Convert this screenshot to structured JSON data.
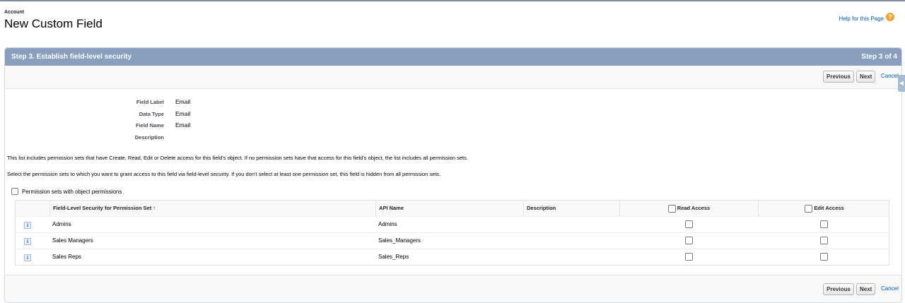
{
  "header": {
    "object_label": "Account",
    "title": "New Custom Field",
    "help_link": "Help for this Page",
    "help_icon": "?"
  },
  "step": {
    "title": "Step 3. Establish field-level security",
    "counter": "Step 3 of 4"
  },
  "buttons": {
    "previous": "Previous",
    "next": "Next",
    "cancel": "Cancel"
  },
  "details": [
    {
      "label": "Field Label",
      "value": "Email"
    },
    {
      "label": "Data Type",
      "value": "Email"
    },
    {
      "label": "Field Name",
      "value": "Email"
    },
    {
      "label": "Description",
      "value": ""
    }
  ],
  "info_text_1": "This list includes permission sets that have Create, Read, Edit or Delete access for this field's object. If no permission sets have that access for this field's object, the list includes all permission sets.",
  "info_text_2": "Select the permission sets to which you want to grant access to this field via field-level security. If you don't select at least one permission set, this field is hidden from all permission sets.",
  "filter_label": "Permission sets with object permissions",
  "table": {
    "columns": {
      "name": "Field-Level Security for Permission Set ↑",
      "api": "API Name",
      "description": "Description",
      "read": "Read Access",
      "edit": "Edit Access"
    },
    "rows": [
      {
        "name": "Admins",
        "api": "Admins",
        "description": ""
      },
      {
        "name": "Sales Managers",
        "api": "Sales_Managers",
        "description": ""
      },
      {
        "name": "Sales Reps",
        "api": "Sales_Reps",
        "description": ""
      }
    ]
  }
}
